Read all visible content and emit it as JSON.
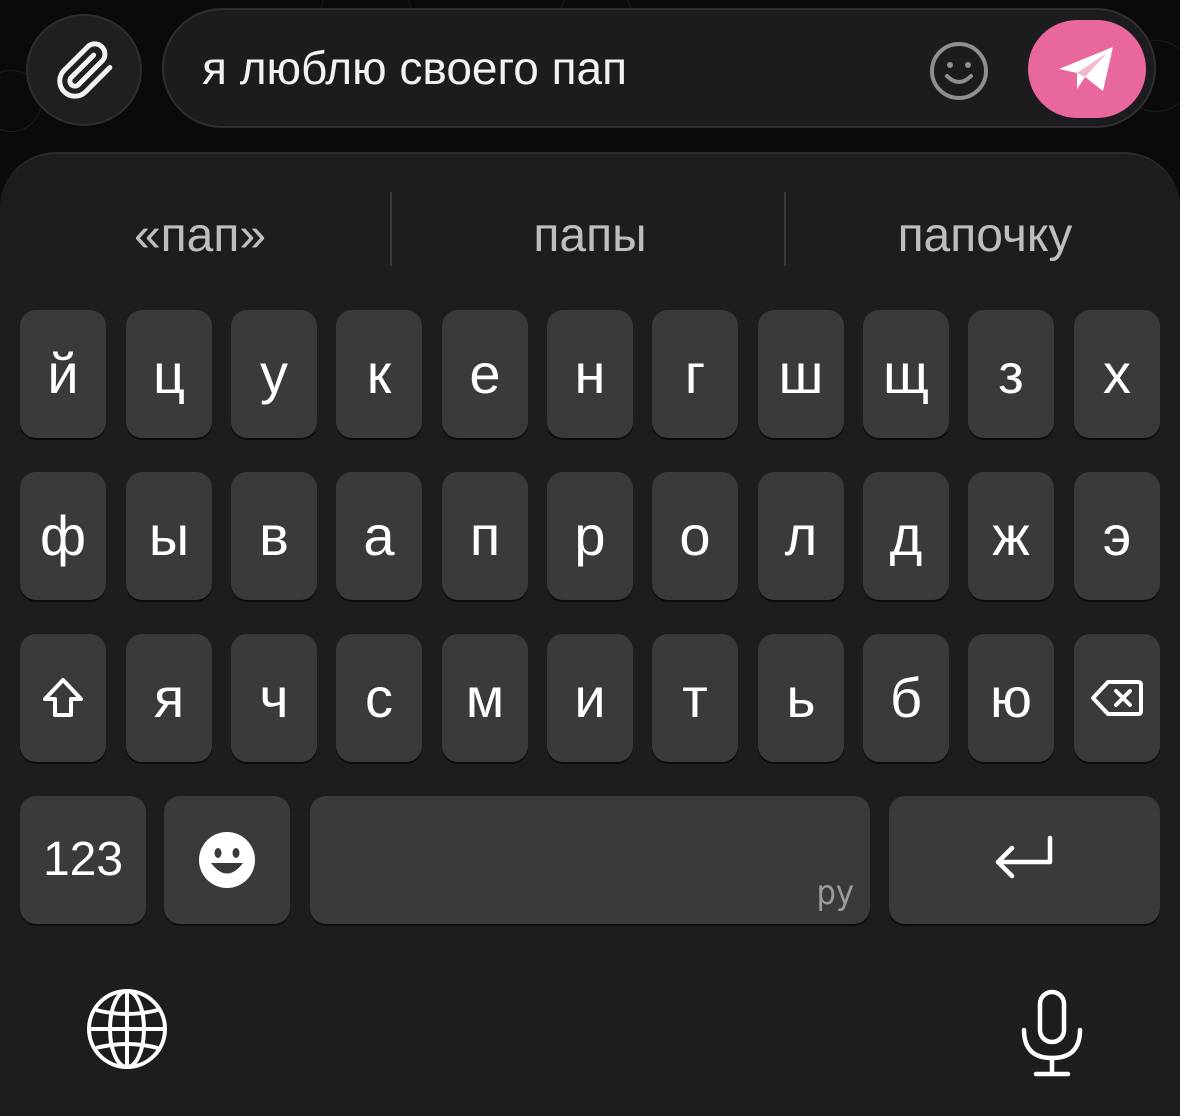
{
  "input": {
    "text": "я люблю своего пап"
  },
  "suggestions": [
    "«пап»",
    "папы",
    "папочку"
  ],
  "keys": {
    "row1": [
      "й",
      "ц",
      "у",
      "к",
      "е",
      "н",
      "г",
      "ш",
      "щ",
      "з",
      "х"
    ],
    "row2": [
      "ф",
      "ы",
      "в",
      "а",
      "п",
      "р",
      "о",
      "л",
      "д",
      "ж",
      "э"
    ],
    "row3": [
      "я",
      "ч",
      "с",
      "м",
      "и",
      "т",
      "ь",
      "б",
      "ю"
    ],
    "numbers": "123",
    "space_lang": "ру"
  },
  "colors": {
    "accent": "#e8679c",
    "key": "#3a3a3c",
    "keyboard_bg": "#1d1d1f"
  }
}
